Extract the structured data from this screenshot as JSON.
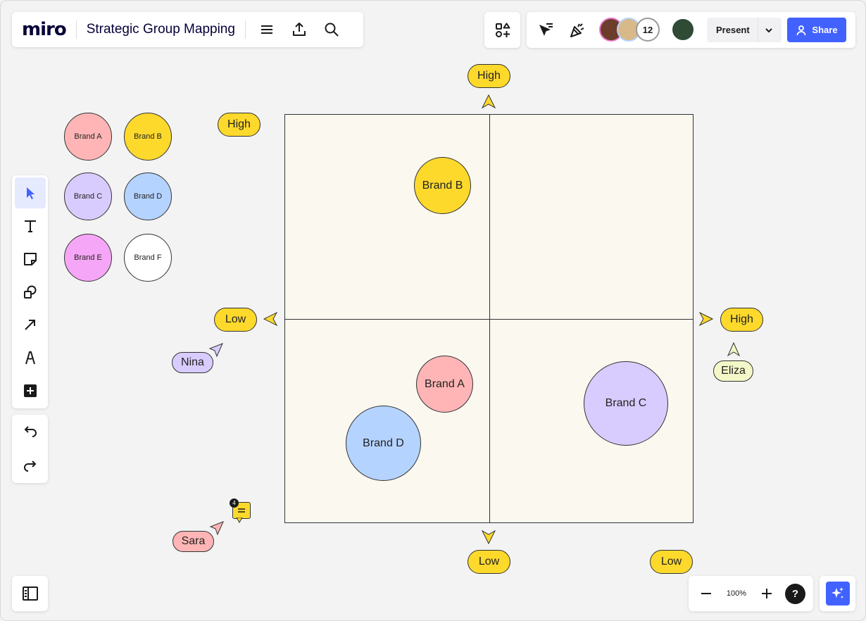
{
  "app": {
    "logo": "miro",
    "board_title": "Strategic Group Mapping"
  },
  "header": {
    "collaborator_count": "12",
    "present_label": "Present",
    "share_label": "Share"
  },
  "zoom": {
    "level": "100%",
    "help": "?"
  },
  "legend": [
    {
      "label": "Brand A",
      "color": "#ffb5b5"
    },
    {
      "label": "Brand B",
      "color": "#fdd92c"
    },
    {
      "label": "Brand C",
      "color": "#d8ccff"
    },
    {
      "label": "Brand D",
      "color": "#b5d3ff"
    },
    {
      "label": "Brand E",
      "color": "#f6a6f6"
    },
    {
      "label": "Brand F",
      "color": "#ffffff"
    }
  ],
  "map": {
    "brands": [
      {
        "label": "Brand B",
        "color": "#fdd92c"
      },
      {
        "label": "Brand A",
        "color": "#ffb5b5"
      },
      {
        "label": "Brand D",
        "color": "#b5d3ff"
      },
      {
        "label": "Brand C",
        "color": "#d8ccff"
      }
    ],
    "axis_labels": {
      "top": "High",
      "bottom": "Low",
      "left": "Low",
      "right": "High",
      "side_high": "High",
      "bottom_right_low": "Low"
    }
  },
  "cursors": [
    {
      "name": "Nina",
      "color": "#d8ccff"
    },
    {
      "name": "Eliza",
      "color": "#f4f8c8"
    },
    {
      "name": "Sara",
      "color": "#ffb5b5"
    }
  ],
  "comment": {
    "count": "4"
  }
}
